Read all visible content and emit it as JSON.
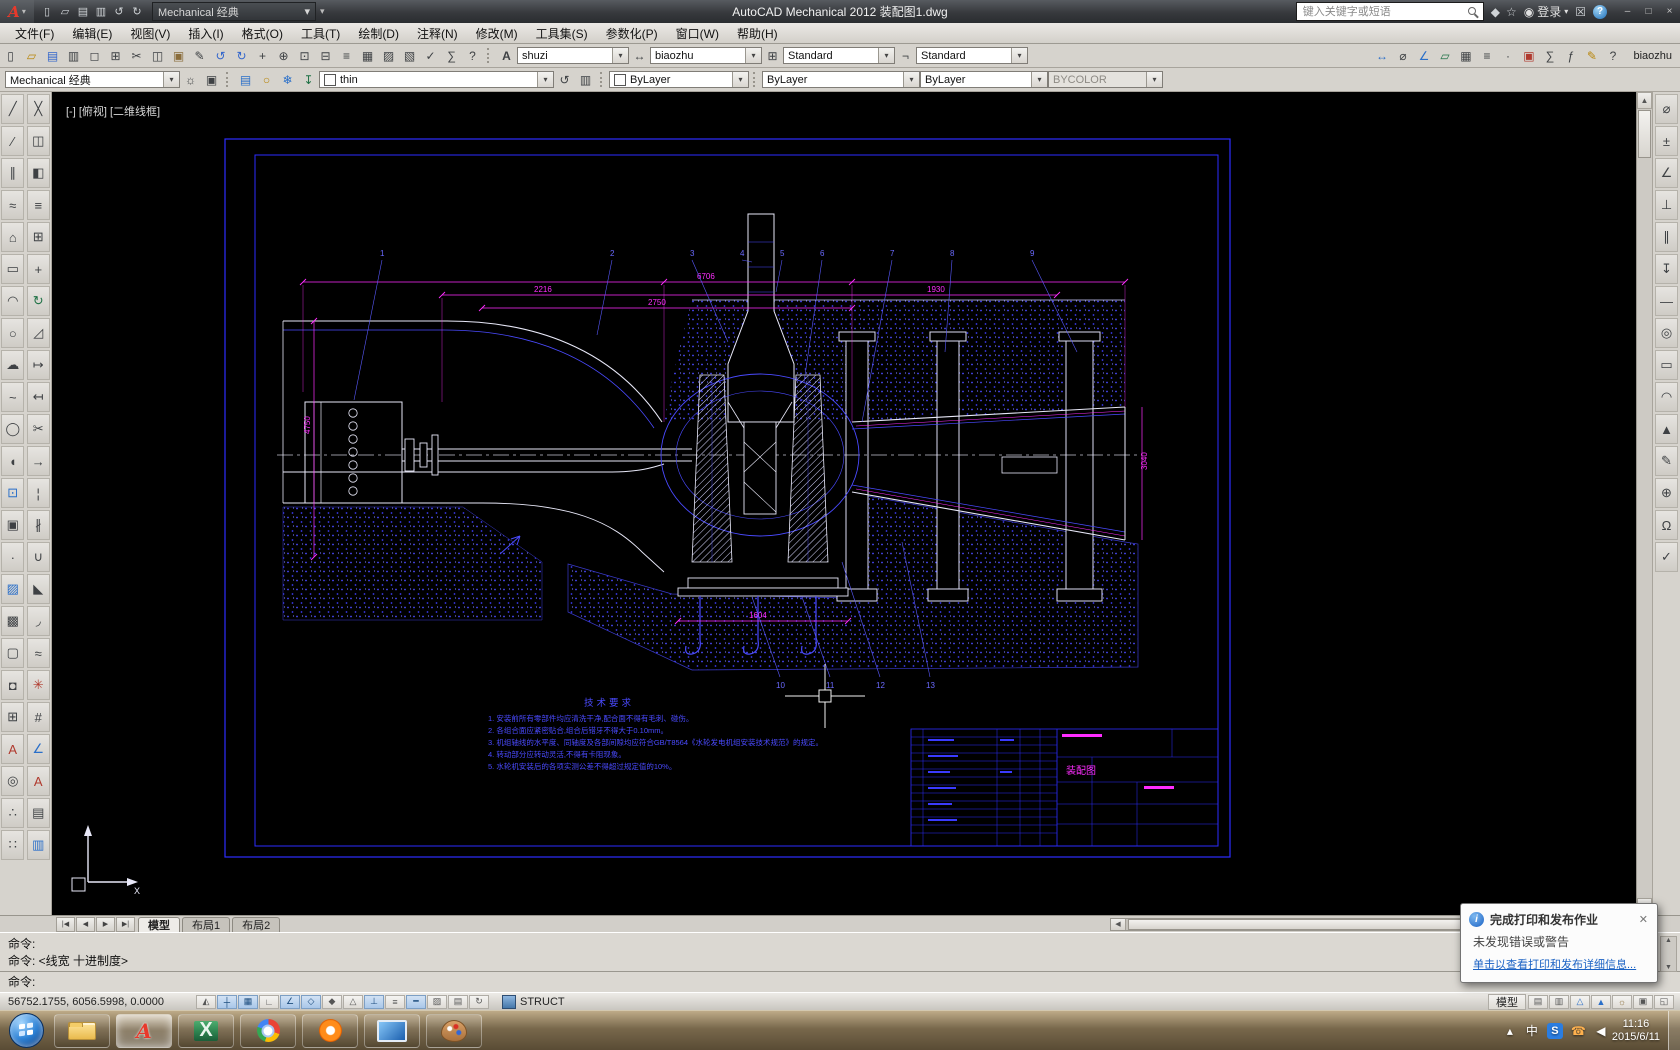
{
  "ui": {
    "dropdown_arrow": "▾",
    "scroll_up": "▲",
    "scroll_down": "▼",
    "scroll_left": "◀",
    "scroll_right": "▶"
  },
  "title_bar": {
    "app_logo": "A",
    "workspace": "Mechanical 经典",
    "title": "AutoCAD Mechanical 2012    装配图1.dwg",
    "qat_icons": [
      {
        "name": "qat-new-icon",
        "glyph": "▯"
      },
      {
        "name": "qat-open-icon",
        "glyph": "▱"
      },
      {
        "name": "qat-save-icon",
        "glyph": "▤"
      },
      {
        "name": "qat-plot-icon",
        "glyph": "▥"
      },
      {
        "name": "qat-undo-icon",
        "glyph": "↺"
      },
      {
        "name": "qat-redo-icon",
        "glyph": "↻"
      }
    ],
    "infocenter": {
      "search_placeholder": "键入关键字或短语",
      "icons": [
        {
          "name": "communication-center-icon",
          "glyph": "◆",
          "color": "#cfd3d6"
        },
        {
          "name": "favorites-icon",
          "glyph": "☆",
          "color": "#cfd3d6"
        }
      ],
      "signin_icon": "◉",
      "signin_label": "登录",
      "exchange_glyph": "☒",
      "help_glyph": "?"
    },
    "window_buttons": [
      {
        "name": "minimize-button",
        "glyph": "–"
      },
      {
        "name": "maximize-button",
        "glyph": "□"
      },
      {
        "name": "close-button",
        "glyph": "×"
      }
    ]
  },
  "menu_bar": {
    "items": [
      "文件(F)",
      "编辑(E)",
      "视图(V)",
      "插入(I)",
      "格式(O)",
      "工具(T)",
      "绘制(D)",
      "注释(N)",
      "修改(M)",
      "工具集(S)",
      "参数化(P)",
      "窗口(W)",
      "帮助(H)"
    ]
  },
  "standard_toolbar": {
    "icons": [
      {
        "name": "new-icon",
        "glyph": "▯"
      },
      {
        "name": "open-icon",
        "glyph": "▱",
        "color": "#b8860b"
      },
      {
        "name": "save-icon",
        "glyph": "▤",
        "color": "#36c"
      },
      {
        "name": "plot-icon",
        "glyph": "▥"
      },
      {
        "name": "plot-preview-icon",
        "glyph": "◻"
      },
      {
        "name": "publish-icon",
        "glyph": "⊞"
      },
      {
        "name": "cut-icon",
        "glyph": "✂"
      },
      {
        "name": "copy-clip-icon",
        "glyph": "◫"
      },
      {
        "name": "paste-icon",
        "glyph": "▣",
        "color": "#8a6d3b"
      },
      {
        "name": "match-properties-icon",
        "glyph": "✎"
      },
      {
        "name": "undo-icon",
        "glyph": "↺",
        "color": "#36c"
      },
      {
        "name": "redo-icon",
        "glyph": "↻",
        "color": "#36c"
      },
      {
        "name": "pan-icon",
        "glyph": "+"
      },
      {
        "name": "zoom-realtime-icon",
        "glyph": "⊕"
      },
      {
        "name": "zoom-window-icon",
        "glyph": "⊡"
      },
      {
        "name": "zoom-previous-icon",
        "glyph": "⊟"
      },
      {
        "name": "properties-icon",
        "glyph": "≡"
      },
      {
        "name": "designcenter-icon",
        "glyph": "▦"
      },
      {
        "name": "tool-palettes-icon",
        "glyph": "▨"
      },
      {
        "name": "sheetset-manager-icon",
        "glyph": "▧"
      },
      {
        "name": "markup-icon",
        "glyph": "✓"
      },
      {
        "name": "quickcalc-icon",
        "glyph": "∑"
      },
      {
        "name": "help-icon",
        "glyph": "?"
      }
    ]
  },
  "style_toolbar": {
    "text_style_icon": "A",
    "text_style": "shuzi",
    "dim_style_icon": "↔",
    "dim_style": "biaozhu",
    "table_style_icon": "⊞",
    "table_style": "Standard",
    "mleader_style_icon": "¬",
    "mleader_style": "Standard",
    "right_icons": [
      {
        "name": "measure-distance-icon",
        "glyph": "↔",
        "color": "#2a6fc9"
      },
      {
        "name": "measure-radius-icon",
        "glyph": "⌀"
      },
      {
        "name": "measure-angle-icon",
        "glyph": "∠",
        "color": "#2a6fc9"
      },
      {
        "name": "measure-area-icon",
        "glyph": "▱",
        "color": "#1e7145"
      },
      {
        "name": "measure-volume-icon",
        "glyph": "▦"
      },
      {
        "name": "list-icon",
        "glyph": "≡"
      },
      {
        "name": "locate-point-icon",
        "glyph": "·"
      },
      {
        "name": "quick-select-icon",
        "glyph": "▣",
        "color": "#b03a2e"
      },
      {
        "name": "quick-calc-icon",
        "glyph": "∑"
      },
      {
        "name": "field-icon",
        "glyph": "ƒ"
      },
      {
        "name": "annotation-icon",
        "glyph": "✎",
        "color": "#b8860b"
      },
      {
        "name": "help2-icon",
        "glyph": "?"
      }
    ],
    "right_label": "biaozhu"
  },
  "layer_toolbar": {
    "workspace": "Mechanical 经典",
    "workspace_icons": [
      {
        "name": "workspace-settings-icon",
        "glyph": "☼"
      },
      {
        "name": "ui-lock-icon",
        "glyph": "▣"
      }
    ],
    "layer_icons": [
      {
        "name": "layer-properties-icon",
        "glyph": "▤",
        "color": "#2a6fc9"
      },
      {
        "name": "layer-off-icon",
        "glyph": "○",
        "color": "#b8860b"
      },
      {
        "name": "layer-freeze-icon",
        "glyph": "❄",
        "color": "#2a6fc9"
      },
      {
        "name": "layer-current-icon",
        "glyph": "↧",
        "color": "#1e7145"
      }
    ],
    "layer_name": "thin",
    "post_layer_icons": [
      {
        "name": "layer-previous-icon",
        "glyph": "↺"
      },
      {
        "name": "layer-states-icon",
        "glyph": "▥"
      }
    ],
    "color_value": "ByLayer",
    "linetype_value": "ByLayer",
    "lineweight_value": "ByLayer",
    "plotstyle_value": "BYCOLOR"
  },
  "draw_toolbar": {
    "icons": [
      {
        "name": "line-icon",
        "glyph": "╱"
      },
      {
        "name": "construction-line-icon",
        "glyph": "⁄"
      },
      {
        "name": "multiline-icon",
        "glyph": "∥"
      },
      {
        "name": "polyline-icon",
        "glyph": "≈"
      },
      {
        "name": "polygon-icon",
        "glyph": "⌂"
      },
      {
        "name": "rectangle-icon",
        "glyph": "▭"
      },
      {
        "name": "arc-icon",
        "glyph": "◠"
      },
      {
        "name": "circle-icon",
        "glyph": "○"
      },
      {
        "name": "revision-cloud-icon",
        "glyph": "☁"
      },
      {
        "name": "spline-icon",
        "glyph": "~"
      },
      {
        "name": "ellipse-icon",
        "glyph": "◯"
      },
      {
        "name": "ellipse-arc-icon",
        "glyph": "◖"
      },
      {
        "name": "insert-block-icon",
        "glyph": "⊡",
        "color": "#2a6fc9"
      },
      {
        "name": "make-block-icon",
        "glyph": "▣"
      },
      {
        "name": "point-icon",
        "glyph": "·"
      },
      {
        "name": "hatch-icon",
        "glyph": "▨",
        "color": "#2a6fc9"
      },
      {
        "name": "gradient-icon",
        "glyph": "▩"
      },
      {
        "name": "region-icon",
        "glyph": "▢"
      },
      {
        "name": "wipeout-icon",
        "glyph": "◘"
      },
      {
        "name": "table-icon",
        "glyph": "⊞"
      },
      {
        "name": "mtext-icon",
        "glyph": "A",
        "color": "#b03a2e"
      },
      {
        "name": "donut-icon",
        "glyph": "◎"
      },
      {
        "name": "divide-icon",
        "glyph": "∴"
      },
      {
        "name": "measure-icon",
        "glyph": "∷"
      }
    ]
  },
  "modify_toolbar": {
    "icons": [
      {
        "name": "erase-icon",
        "glyph": "╳"
      },
      {
        "name": "copy-icon",
        "glyph": "◫"
      },
      {
        "name": "mirror-icon",
        "glyph": "◧"
      },
      {
        "name": "offset-icon",
        "glyph": "≡"
      },
      {
        "name": "array-icon",
        "glyph": "⊞"
      },
      {
        "name": "move-icon",
        "glyph": "+"
      },
      {
        "name": "rotate-icon",
        "glyph": "↻",
        "color": "#1e7145"
      },
      {
        "name": "scale-icon",
        "glyph": "◿"
      },
      {
        "name": "stretch-icon",
        "glyph": "↦"
      },
      {
        "name": "lengthen-icon",
        "glyph": "↤"
      },
      {
        "name": "trim-icon",
        "glyph": "✂"
      },
      {
        "name": "extend-icon",
        "glyph": "→"
      },
      {
        "name": "break-point-icon",
        "glyph": "¦"
      },
      {
        "name": "break-icon",
        "glyph": "∦"
      },
      {
        "name": "join-icon",
        "glyph": "∪"
      },
      {
        "name": "chamfer-icon",
        "glyph": "◣"
      },
      {
        "name": "fillet-icon",
        "glyph": "◞"
      },
      {
        "name": "blend-icon",
        "glyph": "≈"
      },
      {
        "name": "explode-icon",
        "glyph": "✳",
        "color": "#b03a2e"
      },
      {
        "name": "align-icon",
        "glyph": "#"
      },
      {
        "name": "dim-style-tool-icon",
        "glyph": "∠",
        "color": "#2a6fc9"
      },
      {
        "name": "text-style-tool-icon",
        "glyph": "A",
        "color": "#b03a2e"
      },
      {
        "name": "properties-tool-icon",
        "glyph": "▤"
      },
      {
        "name": "layers-tool-icon",
        "glyph": "▥",
        "color": "#2a6fc9"
      }
    ]
  },
  "right_toolbar": {
    "icons": [
      {
        "name": "power-dimension-icon",
        "glyph": "⌀"
      },
      {
        "name": "tolerance-icon",
        "glyph": "±"
      },
      {
        "name": "angle-dim-icon",
        "glyph": "∠"
      },
      {
        "name": "perpendicular-icon",
        "glyph": "⊥"
      },
      {
        "name": "parallel-icon",
        "glyph": "∥"
      },
      {
        "name": "leader-icon",
        "glyph": "↧"
      },
      {
        "name": "centerline-icon",
        "glyph": "—"
      },
      {
        "name": "balloon-icon",
        "glyph": "◎"
      },
      {
        "name": "parts-list-icon",
        "glyph": "▭"
      },
      {
        "name": "surface-symbol-icon",
        "glyph": "◠"
      },
      {
        "name": "weld-symbol-icon",
        "glyph": "▲"
      },
      {
        "name": "annotate-icon",
        "glyph": "✎"
      },
      {
        "name": "zoom-tool-icon",
        "glyph": "⊕"
      },
      {
        "name": "omega-tool-icon",
        "glyph": "Ω"
      },
      {
        "name": "check-tool-icon",
        "glyph": "✓"
      }
    ]
  },
  "drawing": {
    "viewport_label": "[-] [俯视] [二维线框]",
    "dims": {
      "total": "6706",
      "d1": "2216",
      "d2": "1930",
      "d3": "2750",
      "left": "4750",
      "right": "3040",
      "bottom": "1604"
    },
    "balloons_top": [
      "1",
      "2",
      "3",
      "4",
      "5",
      "6",
      "7",
      "8",
      "9"
    ],
    "balloons_bottom": [
      "10",
      "11",
      "12",
      "13"
    ],
    "notes_title": "技术要求",
    "notes": [
      "1. 安装前所有零部件均应清洗干净,配合面不得有毛刺、碰伤。",
      "2. 各组合面应紧密贴合,组合后错牙不得大于0.10mm。",
      "3. 机组轴线的水平度、同轴度及各部间隙均应符合GB/T8564《水轮发电机组安装技术规范》的规定。",
      "4. 转动部分应转动灵活,不得有卡阻现象。",
      "5. 水轮机安装后的各项实测公差不得超过规定值的10%。"
    ],
    "titleblock_name": "装配图",
    "ucs_x_label": "X"
  },
  "layout_tabs": {
    "nav": [
      {
        "name": "first-tab-button",
        "glyph": "|◀"
      },
      {
        "name": "prev-tab-button",
        "glyph": "◀"
      },
      {
        "name": "next-tab-button",
        "glyph": "▶"
      },
      {
        "name": "last-tab-button",
        "glyph": "▶|"
      }
    ],
    "tabs": [
      {
        "name": "tab-model",
        "label": "模型",
        "on": true
      },
      {
        "name": "tab-layout1",
        "label": "布局1"
      },
      {
        "name": "tab-layout2",
        "label": "布局2"
      }
    ]
  },
  "command_line": {
    "history": [
      "命令:",
      "命令:  <线宽 十进制度>"
    ],
    "prompt": "命令:"
  },
  "status_bar": {
    "coords": "56752.1755, 6056.5998, 0.0000",
    "toggles": [
      {
        "name": "infer-constraints-toggle",
        "glyph": "◭"
      },
      {
        "name": "snap-toggle",
        "glyph": "┼",
        "on": true
      },
      {
        "name": "grid-toggle",
        "glyph": "▦",
        "on": true
      },
      {
        "name": "ortho-toggle",
        "glyph": "∟"
      },
      {
        "name": "polar-toggle",
        "glyph": "∠",
        "on": true
      },
      {
        "name": "osnap-toggle",
        "glyph": "◇",
        "on": true
      },
      {
        "name": "osnap3d-toggle",
        "glyph": "◆"
      },
      {
        "name": "otrack-toggle",
        "glyph": "△"
      },
      {
        "name": "ducs-toggle",
        "glyph": "⊥",
        "on": true
      },
      {
        "name": "dyn-toggle",
        "glyph": "≡"
      },
      {
        "name": "lineweight-toggle",
        "glyph": "━",
        "on": true
      },
      {
        "name": "transparency-toggle",
        "glyph": "▨"
      },
      {
        "name": "quick-properties-toggle",
        "glyph": "▤"
      },
      {
        "name": "selection-cycling-toggle",
        "glyph": "↻"
      }
    ],
    "struct_label": "STRUCT",
    "model_label": "模型",
    "right_icons": [
      {
        "name": "quickview-layouts-icon",
        "glyph": "▤"
      },
      {
        "name": "quickview-drawings-icon",
        "glyph": "▥"
      },
      {
        "name": "annotation-scale-icon",
        "glyph": "△",
        "color": "#2a6fc9"
      },
      {
        "name": "annotation-visibility-icon",
        "glyph": "▲",
        "color": "#2a6fc9"
      },
      {
        "name": "workspace-switch-icon",
        "glyph": "☼",
        "color": "#8a6d3b"
      },
      {
        "name": "toolbar-lock-icon",
        "glyph": "▣"
      },
      {
        "name": "clean-screen-icon",
        "glyph": "◱"
      }
    ]
  },
  "taskbar": {
    "apps": [
      {
        "name": "explorer-taskbar-button",
        "cls": "app-folder"
      },
      {
        "name": "autocad-taskbar-button",
        "cls": "app-acad",
        "glyph": "A",
        "on": true
      },
      {
        "name": "excel-taskbar-button",
        "cls": "app-excel",
        "glyph": "X"
      },
      {
        "name": "chrome-taskbar-button",
        "cls": "app-chrome"
      },
      {
        "name": "orange-browser-taskbar-button",
        "cls": "app-orange"
      },
      {
        "name": "computer-taskbar-button",
        "cls": "app-computer"
      },
      {
        "name": "paint-taskbar-button",
        "cls": "app-paint"
      }
    ],
    "tray": [
      {
        "name": "hidden-icons-button",
        "glyph": "▴"
      },
      {
        "name": "ime-chinese-indicator",
        "glyph": "中"
      },
      {
        "name": "s-app-tray-icon",
        "glyph": "S",
        "cls": "tray-s"
      },
      {
        "name": "phone-tray-icon",
        "glyph": "☎",
        "color": "#ffb14e"
      },
      {
        "name": "volume-tray-icon",
        "glyph": "◀"
      }
    ],
    "clock": {
      "time": "11:16",
      "date": "2015/6/11"
    }
  },
  "notification": {
    "info_glyph": "i",
    "title": "完成打印和发布作业",
    "body": "未发现错误或警告",
    "link": "单击以查看打印和发布详细信息...",
    "close_glyph": "✕"
  }
}
